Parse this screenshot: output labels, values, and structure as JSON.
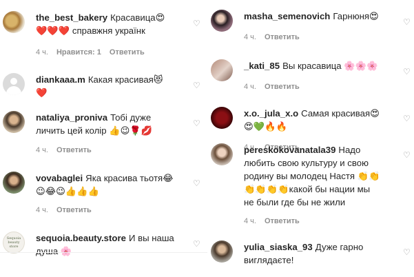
{
  "left": [
    {
      "user": "the_best_bakery",
      "text": "Красавица😍",
      "text2": "❤️❤️❤️ справжня українк",
      "time": "4 ч.",
      "likes": "Нравится: 1",
      "reply": "Ответить"
    },
    {
      "user": "diankaaa.m",
      "text": "Какая красивая😻",
      "text2": "❤️",
      "time": "",
      "likes": "",
      "reply": ""
    },
    {
      "user": "nataliya_proniva",
      "text": "Тобі дуже",
      "text2": "личить цей колір 👍😉🌹💋",
      "time": "4 ч.",
      "likes": "",
      "reply": "Ответить"
    },
    {
      "user": "vovabaglei",
      "text": "Яка красива тьотя😂",
      "text2": "😉😂😉👍👍👍",
      "time": "4 ч.",
      "likes": "",
      "reply": "Ответить"
    },
    {
      "user": "sequoia.beauty.store",
      "text": "И вы наша",
      "text2": "душа 🌸",
      "time": "",
      "likes": "",
      "reply": ""
    }
  ],
  "right": [
    {
      "user": "masha_semenovich",
      "text": "Гарнюня😍",
      "text2": "",
      "time": "4 ч.",
      "likes": "",
      "reply": "Ответить"
    },
    {
      "user": "_kati_85",
      "text": "Вы красавица 🌸🌸🌸",
      "text2": "",
      "time": "4 ч.",
      "likes": "",
      "reply": "Ответить"
    },
    {
      "user": "x.o._jula_x.o",
      "text": "Самая красивая😍",
      "text2": "😍💚🔥🔥",
      "time": "4 ч.",
      "likes": "",
      "reply": "Ответить"
    },
    {
      "user": "pereskokovanatala39",
      "text": "Надо",
      "line2": "любить свою культуру и свою",
      "line3": "родину вы молодец Настя 👏👏",
      "line4": "👏👏👏👏какой бы нации мы",
      "line5": "не были где бы не жили",
      "time": "4 ч.",
      "likes": "",
      "reply": "Ответить"
    },
    {
      "user": "yulia_siaska_93",
      "text": "Дуже гарно",
      "text2": "виглядаєте!",
      "time": "",
      "likes": "",
      "reply": ""
    }
  ],
  "avatar_text": {
    "sequoia": [
      "Sequoia",
      "beauty",
      "store"
    ]
  },
  "icons": {
    "like": "heart-outline-icon"
  }
}
